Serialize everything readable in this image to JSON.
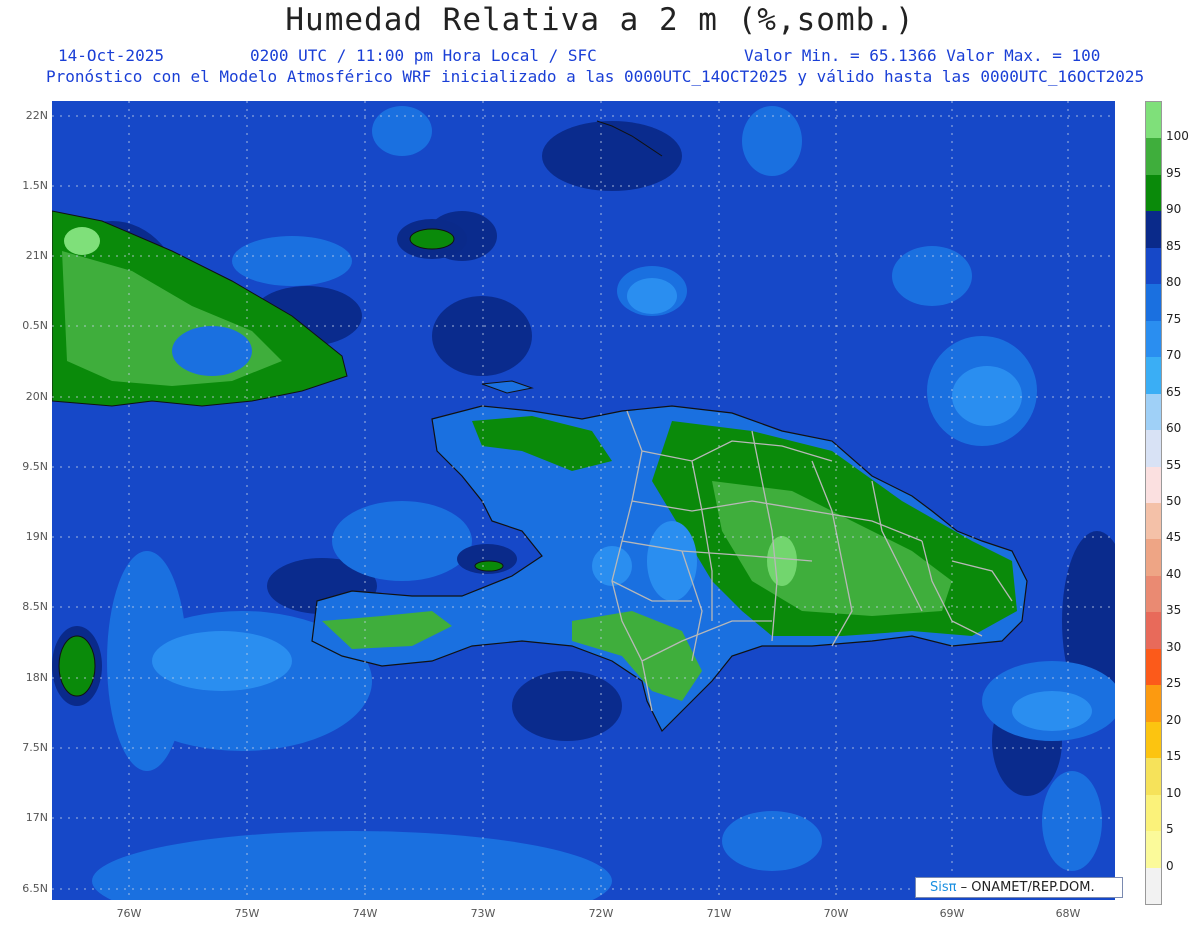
{
  "title": "Humedad Relativa a 2 m (%,somb.)",
  "info": {
    "date": "14-Oct-2025",
    "time": "0200 UTC / 11:00 pm Hora Local / SFC",
    "minmax": "Valor Min. = 65.1366  Valor Max. = 100",
    "model": "Pronóstico con el Modelo Atmosférico WRF inicializado a las 0000UTC_14OCT2025 y válido hasta las  0000UTC_16OCT2025"
  },
  "axes": {
    "lat_labels": [
      "22N",
      "1.5N",
      "21N",
      "0.5N",
      "20N",
      "9.5N",
      "19N",
      "8.5N",
      "18N",
      "7.5N",
      "17N",
      "6.5N"
    ],
    "lon_labels": [
      "76W",
      "75W",
      "74W",
      "73W",
      "72W",
      "71W",
      "70W",
      "69W",
      "68W"
    ]
  },
  "colorbar": {
    "labels": [
      "100",
      "95",
      "90",
      "85",
      "80",
      "75",
      "70",
      "65",
      "60",
      "55",
      "50",
      "45",
      "40",
      "35",
      "30",
      "25",
      "20",
      "15",
      "10",
      "5",
      "0"
    ],
    "colors": [
      "#7fe07a",
      "#3fae3c",
      "#0a8a0a",
      "#0a2a8a",
      "#1648c8",
      "#1a70e0",
      "#2a8ef0",
      "#3aaef5",
      "#9fd0f7",
      "#d8e2f5",
      "#fbe0e0",
      "#f4c1a8",
      "#eea585",
      "#ea8a72",
      "#e86a5a",
      "#fc5a1a",
      "#fc9a10",
      "#fcc410",
      "#f6e25a",
      "#fbf27a",
      "#fbfa9a",
      "#f2f2f2"
    ]
  },
  "credit": {
    "logo": "Sisπ",
    "text": "– ONAMET/REP.DOM."
  },
  "colors": {
    "ocean": "#1648c8",
    "shallow": "#1a70e0",
    "deep": "#0a2a8a",
    "land_green": "#0a8a0a",
    "land_mid": "#3fae3c",
    "land_light": "#7fe07a",
    "coast": "#111111",
    "border": "#b8b8b8"
  }
}
